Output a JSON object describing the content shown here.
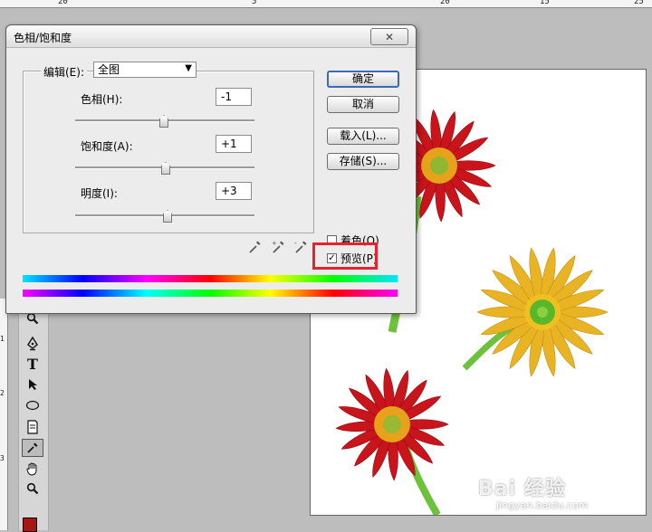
{
  "ruler_top": {
    "labels": [
      "20",
      "5",
      "20",
      "15",
      "25"
    ]
  },
  "ruler_left": {
    "labels": [
      "1",
      "2",
      "3"
    ]
  },
  "dialog": {
    "title": "色相/饱和度",
    "close_label": "✕",
    "edit_label": "编辑(E):",
    "edit_value": "全图",
    "hue_label": "色相(H):",
    "hue_value": "-1",
    "saturation_label": "饱和度(A):",
    "saturation_value": "+1",
    "lightness_label": "明度(I):",
    "lightness_value": "+3",
    "ok_label": "确定",
    "cancel_label": "取消",
    "load_label": "载入(L)...",
    "save_label": "存储(S)...",
    "colorize_label": "着色(O)",
    "preview_label": "预览(P)"
  },
  "sliders": {
    "hue": 0.495,
    "saturation": 0.505,
    "lightness": 0.515
  },
  "toolbox": {
    "icons": [
      "magnifier-icon",
      "pen-icon",
      "type-icon",
      "path-select-icon",
      "ellipse-icon",
      "notes-icon",
      "eyedropper-icon",
      "hand-icon",
      "zoom-icon"
    ],
    "type_glyph": "T",
    "foreground_color": "#a81812"
  },
  "watermark": {
    "text": "Bai 经验",
    "sub": "jingyan.baidu.com"
  },
  "colors": {
    "highlight": "#e8212a",
    "red_petal": "#c8141a",
    "yellow_petal": "#e8b424",
    "stem": "#6cc23a"
  }
}
